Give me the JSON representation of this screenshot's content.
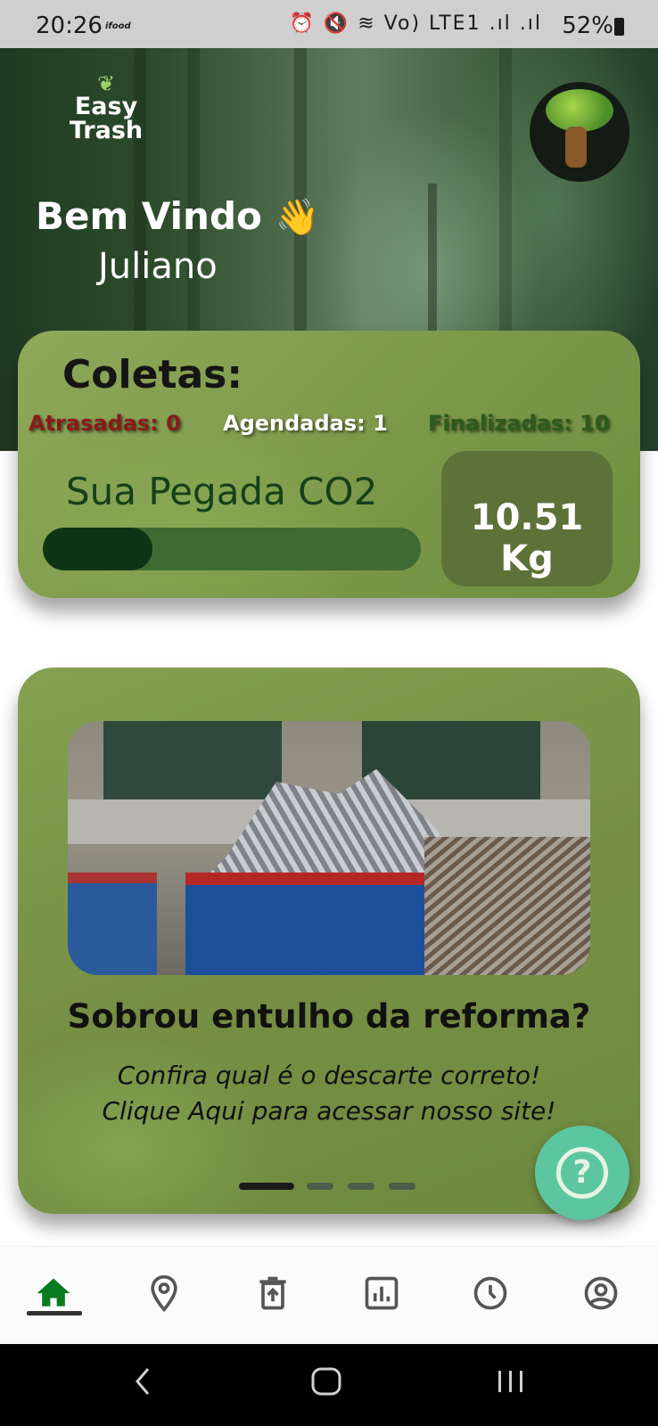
{
  "status_bar": {
    "time": "20:26",
    "app_tag": "ifood",
    "indicators": "⏰ 🔇 ≋ Vo) LTE1 .ıl .ıl",
    "battery": "52%"
  },
  "header": {
    "logo_line1": "Easy",
    "logo_line2": "Trash",
    "welcome": "Bem Vindo",
    "wave_emoji": "👋",
    "user_name": "Juliano"
  },
  "collections_card": {
    "title": "Coletas:",
    "late": "Atrasadas: 0",
    "scheduled": "Agendadas: 1",
    "finished": "Finalizadas: 10",
    "co2_label": "Sua Pegada CO2",
    "co2_value": "10.51 Kg",
    "co2_progress": 0.29
  },
  "banner": {
    "title": "Sobrou entulho da reforma?",
    "subtitle_line1": "Confira qual é o descarte correto!",
    "subtitle_line2": "Clique Aqui para acessar nosso site!",
    "slides": 4,
    "active_slide": 0
  },
  "help_button": {
    "label": "?"
  },
  "bottom_nav": {
    "items": [
      "home-icon",
      "map-pin-icon",
      "trash-icon",
      "chart-icon",
      "history-clock-icon",
      "profile-icon"
    ],
    "active": "home-icon",
    "active_color": "#0a7a1e",
    "inactive_color": "#555555"
  },
  "colors": {
    "card_green": "#7d9a4a",
    "progress_dark": "#0f3414",
    "late_red": "#8a1a1a",
    "finished_green": "#2d5a1e",
    "fab_teal": "#5cc6a0"
  }
}
